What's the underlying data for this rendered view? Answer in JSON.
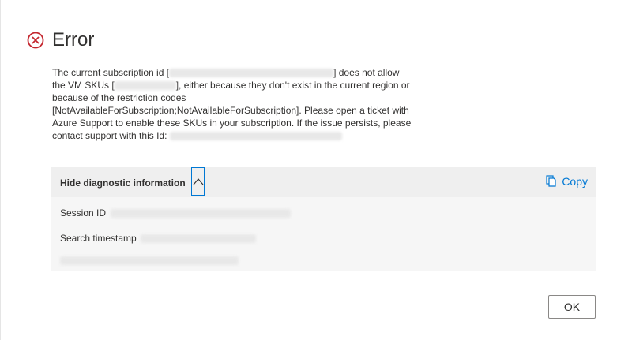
{
  "header": {
    "title": "Error",
    "icon": "error-circle-icon",
    "icon_color": "#c4262e"
  },
  "message": {
    "part1": "The current subscription id [",
    "part2": "] does not allow",
    "part3": "the VM SKUs [",
    "part4": "], either because they don't exist in the current region or",
    "part5": "because of the restriction codes",
    "part6": "[NotAvailableForSubscription;NotAvailableForSubscription]. Please open a ticket with",
    "part7": "Azure Support to enable these SKUs in your subscription. If the issue persists, please",
    "part8": "contact support with this Id:"
  },
  "diagnostics": {
    "toggle_label": "Hide diagnostic information",
    "copy_label": "Copy",
    "session_id_label": "Session ID",
    "search_timestamp_label": "Search timestamp"
  },
  "footer": {
    "ok_label": "OK"
  },
  "colors": {
    "accent": "#0078d4",
    "error": "#c4262e"
  }
}
